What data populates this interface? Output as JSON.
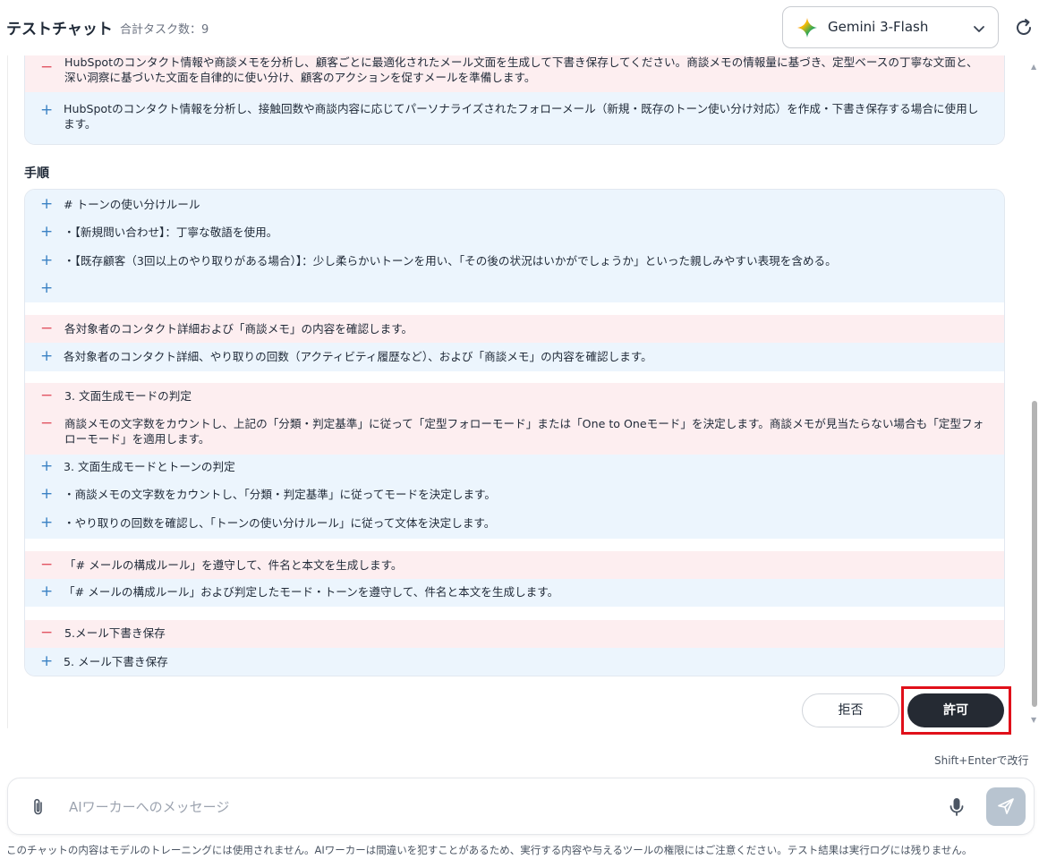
{
  "header": {
    "title": "テストチャット",
    "task_count": "合計タスク数：9",
    "model": "Gemini 3-Flash",
    "model_icon": "gemini-sparkle-icon",
    "refresh_icon": "refresh-icon"
  },
  "diff_top": [
    {
      "type": "del",
      "text": "HubSpotのコンタクト情報や商談メモを分析し、顧客ごとに最適化されたメール文面を生成して下書き保存してください。商談メモの情報量に基づき、定型ベースの丁寧な文面と、深い洞察に基づいた文面を自律的に使い分け、顧客のアクションを促すメールを準備します。"
    },
    {
      "type": "add",
      "text": "HubSpotのコンタクト情報を分析し、接触回数や商談内容に応じてパーソナライズされたフォローメール（新規・既存のトーン使い分け対応）を作成・下書き保存する場合に使用します。"
    }
  ],
  "section_label": "手順",
  "diff_steps": [
    {
      "type": "add",
      "text": "# トーンの使い分けルール"
    },
    {
      "type": "add",
      "text": "・【新規問い合わせ】：丁寧な敬語を使用。"
    },
    {
      "type": "add",
      "text": "・【既存顧客（3回以上のやり取りがある場合）】：少し柔らかいトーンを用い、「その後の状況はいかがでしょうか」といった親しみやすい表現を含める。"
    },
    {
      "type": "add",
      "text": ""
    },
    {
      "type": "del",
      "text": "各対象者のコンタクト詳細および「商談メモ」の内容を確認します。"
    },
    {
      "type": "add",
      "text": "各対象者のコンタクト詳細、やり取りの回数（アクティビティ履歴など）、および「商談メモ」の内容を確認します。"
    },
    {
      "type": "del",
      "text": "3. 文面生成モードの判定"
    },
    {
      "type": "del",
      "text": "商談メモの文字数をカウントし、上記の「分類・判定基準」に従って「定型フォローモード」または「One to Oneモード」を決定します。商談メモが見当たらない場合も「定型フォローモード」を適用します。"
    },
    {
      "type": "add",
      "text": "3. 文面生成モードとトーンの判定"
    },
    {
      "type": "add",
      "text": "・商談メモの文字数をカウントし、「分類・判定基準」に従ってモードを決定します。"
    },
    {
      "type": "add",
      "text": "・やり取りの回数を確認し、「トーンの使い分けルール」に従って文体を決定します。"
    },
    {
      "type": "del",
      "text": "「# メールの構成ルール」を遵守して、件名と本文を生成します。"
    },
    {
      "type": "add",
      "text": "「# メールの構成ルール」および判定したモード・トーンを遵守して、件名と本文を生成します。"
    },
    {
      "type": "del",
      "text": "5.メール下書き保存"
    },
    {
      "type": "add",
      "text": "5. メール下書き保存"
    }
  ],
  "marks": {
    "del": "−",
    "add": "+"
  },
  "buttons": {
    "reject": "拒否",
    "allow": "許可"
  },
  "hint": "Shift+Enterで改行",
  "composer": {
    "placeholder": "AIワーカーへのメッセージ",
    "value": ""
  },
  "disclaimer": "このチャットの内容はモデルのトレーニングには使用されません。AIワーカーは間違いを犯すことがあるため、実行する内容や与えるツールの権限にはご注意ください。テスト結果は実行ログには残りません。",
  "colors": {
    "del_bg": "#fdeef0",
    "add_bg": "#ecf5fd",
    "del_mark": "#e25563",
    "add_mark": "#3b82c4",
    "allow_bg": "#252a33",
    "highlight": "#e0101a"
  }
}
